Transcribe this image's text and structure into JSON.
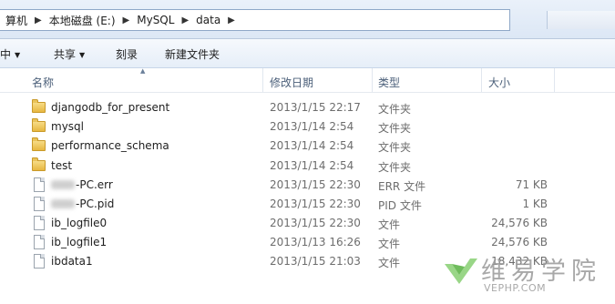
{
  "address": {
    "crumbs": [
      "算机",
      "本地磁盘 (E:)",
      "MySQL",
      "data"
    ]
  },
  "toolbar": {
    "include_label": "中",
    "share_label": "共享",
    "burn_label": "刻录",
    "new_folder_label": "新建文件夹"
  },
  "columns": {
    "name": "名称",
    "date": "修改日期",
    "type": "类型",
    "size": "大小"
  },
  "files": [
    {
      "name": "djangodb_for_present",
      "date": "2013/1/15 22:17",
      "type": "文件夹",
      "size": "",
      "icon": "folder-icon"
    },
    {
      "name": "mysql",
      "date": "2013/1/14 2:54",
      "type": "文件夹",
      "size": "",
      "icon": "folder-icon"
    },
    {
      "name": "performance_schema",
      "date": "2013/1/14 2:54",
      "type": "文件夹",
      "size": "",
      "icon": "folder-icon"
    },
    {
      "name": "test",
      "date": "2013/1/14 2:54",
      "type": "文件夹",
      "size": "",
      "icon": "folder-icon"
    },
    {
      "name": "-PC.err",
      "date": "2013/1/15 22:30",
      "type": "ERR 文件",
      "size": "71 KB",
      "icon": "file-icon"
    },
    {
      "name": "-PC.pid",
      "date": "2013/1/15 22:30",
      "type": "PID 文件",
      "size": "1 KB",
      "icon": "file-icon"
    },
    {
      "name": "ib_logfile0",
      "date": "2013/1/15 22:30",
      "type": "文件",
      "size": "24,576 KB",
      "icon": "file-icon"
    },
    {
      "name": "ib_logfile1",
      "date": "2013/1/13 16:26",
      "type": "文件",
      "size": "24,576 KB",
      "icon": "file-icon"
    },
    {
      "name": "ibdata1",
      "date": "2013/1/15 21:03",
      "type": "文件",
      "size": "18,432 KB",
      "icon": "file-icon"
    }
  ],
  "watermark": {
    "text_cn": "维易学院",
    "text_en": "VEPHP.COM"
  }
}
